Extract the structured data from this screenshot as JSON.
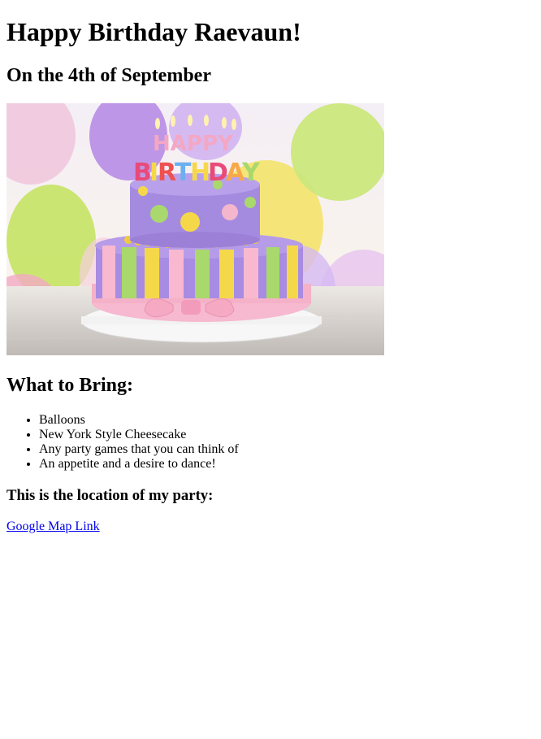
{
  "page": {
    "title": "Happy Birthday Raevaun!",
    "subtitle": "On the 4th of September"
  },
  "image": {
    "alt": "Birthday cake",
    "cake_letters_top": "HAPPY",
    "cake_letters_bottom": "BIRTHDAY",
    "colors": {
      "purple": "#a58be0",
      "yellow": "#f5d84a",
      "green": "#a9d86c",
      "pink": "#f4b6cc",
      "plate": "#f2f2f2"
    }
  },
  "bring": {
    "heading": "What to Bring:",
    "items": [
      "Balloons",
      "New York Style Cheesecake",
      "Any party games that you can think of",
      "An appetite and a desire to dance!"
    ]
  },
  "location": {
    "heading": "This is the location of my party:",
    "link_text": "Google Map Link",
    "link_color": "#0000ee"
  }
}
